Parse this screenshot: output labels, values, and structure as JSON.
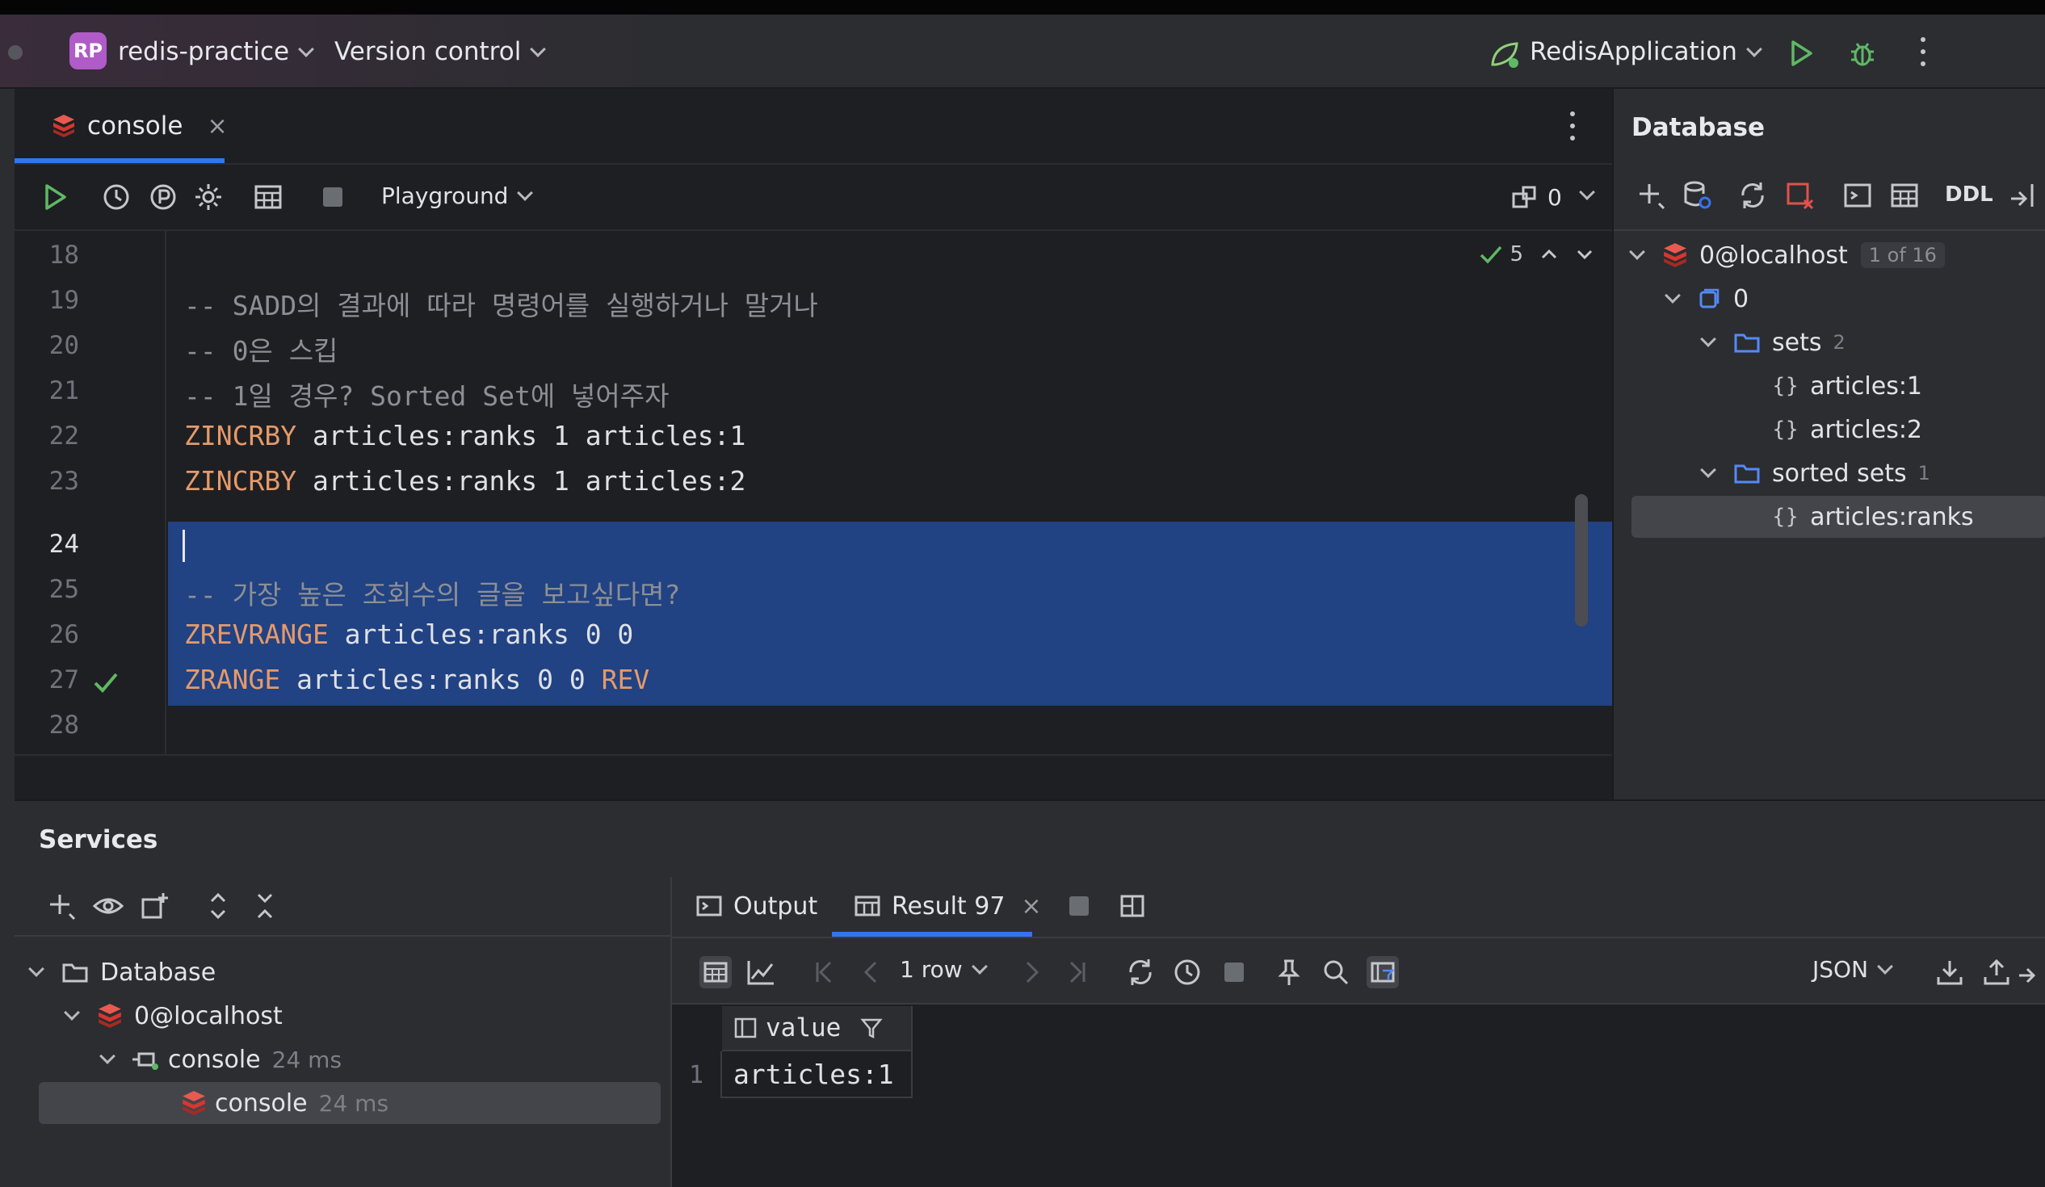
{
  "titlebar": {
    "project_badge": "RP",
    "project_name": "redis-practice",
    "vcs_label": "Version control",
    "run_config": "RedisApplication"
  },
  "editor": {
    "tab_label": "console",
    "tab_close": "×",
    "playground_label": "Playground",
    "session_count": "0",
    "inspection_count": "5",
    "line_numbers": [
      "18",
      "19",
      "20",
      "21",
      "22",
      "23",
      "24",
      "25",
      "26",
      "27",
      "28"
    ],
    "lines": [
      {
        "comment": ""
      },
      {
        "comment": "-- SADD의 결과에 따라 명령어를 실행하거나 말거나"
      },
      {
        "comment": "-- 0은 스킵"
      },
      {
        "comment": "-- 1일 경우? Sorted Set에 넣어주자"
      },
      {
        "kw": "ZINCRBY",
        "rest": " articles:ranks 1 articles:1"
      },
      {
        "kw": "ZINCRBY",
        "rest": " articles:ranks 1 articles:2"
      },
      {
        "comment": ""
      },
      {
        "comment": "-- 가장 높은 조회수의 글을 보고싶다면?"
      },
      {
        "kw": "ZREVRANGE",
        "rest": " articles:ranks 0 0"
      },
      {
        "kw": "ZRANGE",
        "rest": " articles:ranks 0 0 ",
        "kw2": "REV"
      },
      {
        "comment": ""
      }
    ]
  },
  "database": {
    "title": "Database",
    "ddl_label": "DDL",
    "tree": {
      "host": "0@localhost",
      "host_badge": "1 of 16",
      "db": "0",
      "sets_label": "sets",
      "sets_count": "2",
      "set_items": [
        "articles:1",
        "articles:2"
      ],
      "sorted_label": "sorted sets",
      "sorted_count": "1",
      "sorted_items": [
        "articles:ranks"
      ]
    }
  },
  "services": {
    "title": "Services",
    "tree": {
      "root": "Database",
      "host": "0@localhost",
      "session": "console",
      "session_time": "24 ms",
      "console": "console",
      "console_time": "24 ms"
    },
    "tabs": {
      "output": "Output",
      "result": "Result 97",
      "result_close": "×"
    },
    "toolbar": {
      "rows_label": "1 row",
      "format": "JSON"
    },
    "grid": {
      "column": "value",
      "rows": [
        {
          "num": "1",
          "value": "articles:1"
        }
      ]
    }
  },
  "colors": {
    "accent": "#3574f0",
    "selection": "#214283",
    "keyword": "#e59a6a",
    "comment": "#8c8f94",
    "redis": "#d6362f",
    "run_green": "#5fb865"
  }
}
